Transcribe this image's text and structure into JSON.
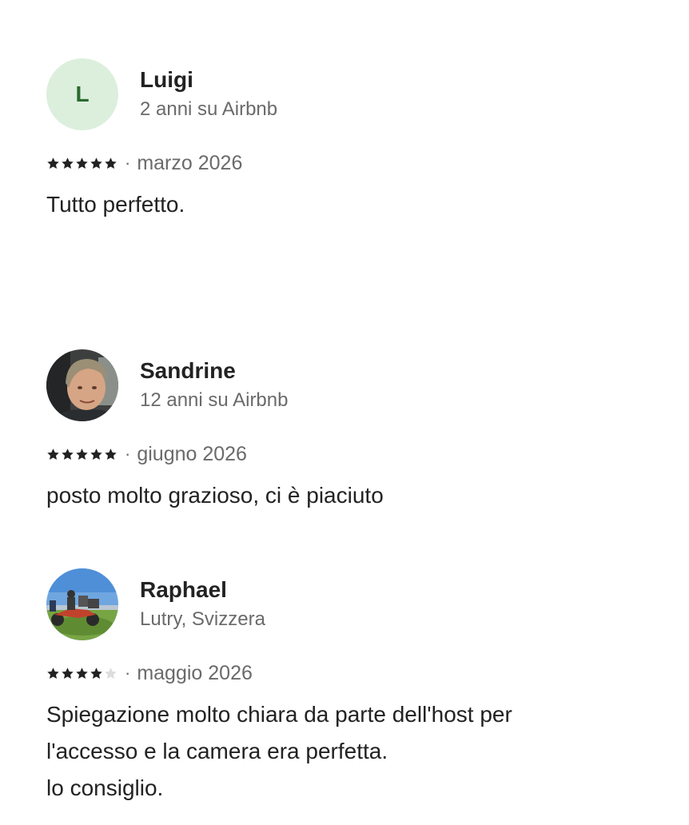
{
  "reviews": [
    {
      "name": "Luigi",
      "avatar_initial": "L",
      "subtitle": "2 anni su Airbnb",
      "rating": 5,
      "separator": "·",
      "date": "marzo 2026",
      "text_lines": [
        "Tutto perfetto."
      ]
    },
    {
      "name": "Sandrine",
      "avatar_icon": "person-photo",
      "subtitle": "12 anni su Airbnb",
      "rating": 5,
      "separator": "·",
      "date": "giugno 2026",
      "text_lines": [
        "posto molto grazioso, ci è piaciuto"
      ]
    },
    {
      "name": "Raphael",
      "avatar_icon": "motorcycle-photo",
      "subtitle": "Lutry, Svizzera",
      "rating": 4,
      "separator": "·",
      "date": "maggio 2026",
      "text_lines": [
        "Spiegazione molto chiara da parte dell'host per",
        "l'accesso e la camera era perfetta.",
        "lo consiglio."
      ]
    }
  ],
  "colors": {
    "star_filled": "#222222",
    "star_empty": "#dddddd",
    "avatar_initial_bg": "#dcefdd",
    "avatar_initial_fg": "#2b6a2f"
  }
}
